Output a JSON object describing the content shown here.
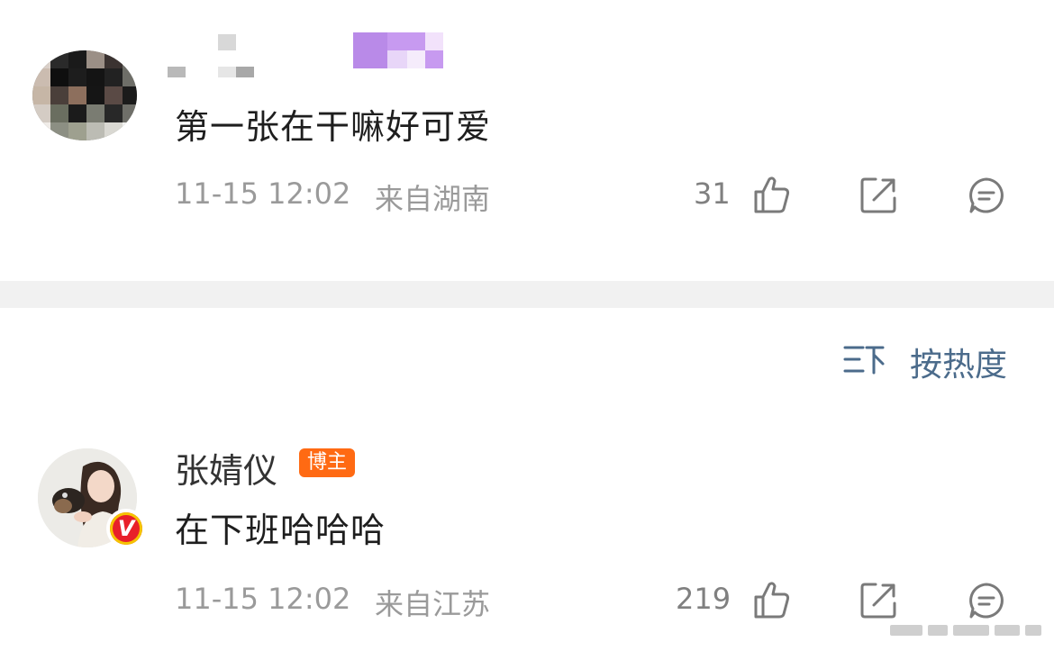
{
  "comments": [
    {
      "text": "第一张在干嘛好可爱",
      "time": "11-15 12:02",
      "location": "来自湖南",
      "likes": "31"
    },
    {
      "username": "张婧仪",
      "badge": "博主",
      "verified_mark": "V",
      "text": "在下班哈哈哈",
      "time": "11-15 12:02",
      "location": "来自江苏",
      "likes": "219"
    }
  ],
  "sort": {
    "label": "按热度"
  },
  "icons": {
    "like": "thumbs-up-icon",
    "share": "share-icon",
    "comment": "comment-icon",
    "sort": "sort-icon"
  },
  "colors": {
    "badge": "#ff6a13",
    "sort_text": "#4b6b8b",
    "meta_text": "#9a9a9a",
    "verified": "#e8202a"
  }
}
